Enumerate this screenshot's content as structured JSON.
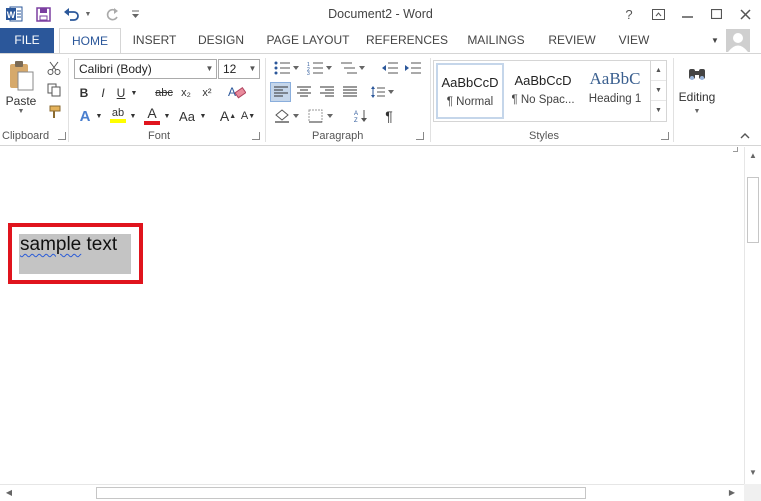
{
  "window": {
    "title": "Document2 - Word",
    "help": "?",
    "controls": {
      "minimize": "—",
      "restore": "☐",
      "close": "✕"
    }
  },
  "qat": {
    "app_icon": "W",
    "save": "save-icon",
    "undo": "undo-icon",
    "redo": "redo-icon",
    "customize": "customize-icon"
  },
  "tabs": [
    "FILE",
    "HOME",
    "INSERT",
    "DESIGN",
    "PAGE LAYOUT",
    "REFERENCES",
    "MAILINGS",
    "REVIEW",
    "VIEW"
  ],
  "ribbon": {
    "clipboard": {
      "label": "Clipboard",
      "paste": "Paste"
    },
    "font": {
      "label": "Font",
      "family": "Calibri (Body)",
      "size": "12",
      "bold": "B",
      "italic": "I",
      "underline": "U",
      "strike": "abc",
      "subscript": "x₂",
      "superscript": "x²",
      "text_effects": "A",
      "highlight": "ab",
      "font_color": "A",
      "change_case": "Aa",
      "grow": "A",
      "shrink": "A"
    },
    "paragraph": {
      "label": "Paragraph",
      "pilcrow": "¶"
    },
    "styles": {
      "label": "Styles",
      "items": [
        {
          "preview": "AaBbCcD",
          "name": "¶ Normal"
        },
        {
          "preview": "AaBbCcD",
          "name": "¶ No Spac..."
        },
        {
          "preview": "AaBbC",
          "name": "Heading 1"
        }
      ]
    },
    "editing": {
      "label": "Editing"
    }
  },
  "document": {
    "content_word1": "sample",
    "content_word2": " text"
  },
  "colors": {
    "accent": "#2b579a",
    "highlight_border": "#e0141d",
    "selection": "#c4c4c4"
  }
}
